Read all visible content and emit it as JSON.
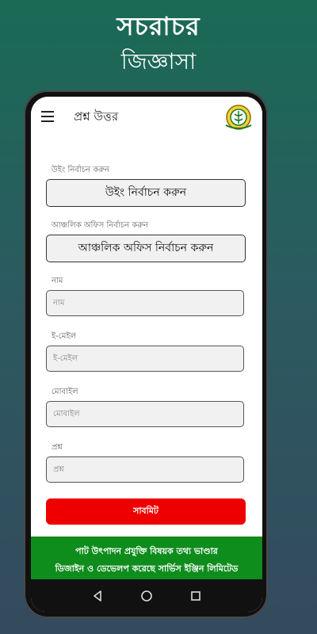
{
  "promo": {
    "title": "সচরাচর",
    "subtitle": "জিজ্ঞাসা"
  },
  "appbar": {
    "title": "প্রশ্ন উত্তর",
    "menu_icon": "hamburger-menu-icon",
    "logo_icon": "organization-logo-icon"
  },
  "form": {
    "wing": {
      "label": "উইং নির্বাচন করুন",
      "selected": "উইং নির্বাচন করুন"
    },
    "office": {
      "label": "আঞ্চলিক অফিস নির্বাচন করুন",
      "selected": "আঞ্চলিক অফিস নির্বাচন করুন"
    },
    "name": {
      "label": "নাম",
      "placeholder": "নাম"
    },
    "email": {
      "label": "ই-মেইল",
      "placeholder": "ই-মেইল"
    },
    "mobile": {
      "label": "মোবাইল",
      "placeholder": "মোবাইল"
    },
    "question": {
      "label": "প্রশ্ন",
      "placeholder": "প্রশ্ন"
    },
    "submit_label": "সাবমিট"
  },
  "footer": {
    "line1": "পাট উৎপাদন প্রযুক্তি বিষয়ক তথ্য ভাণ্ডার",
    "line2": "ডিজাইন ও ডেভেলপ করেছে সার্ভিস ইঞ্জিন লিমিটেড"
  },
  "colors": {
    "submit": "#ee0000",
    "footer": "#0e8c1c",
    "background_top": "#1a6a55",
    "background_bottom": "#344a5e"
  }
}
